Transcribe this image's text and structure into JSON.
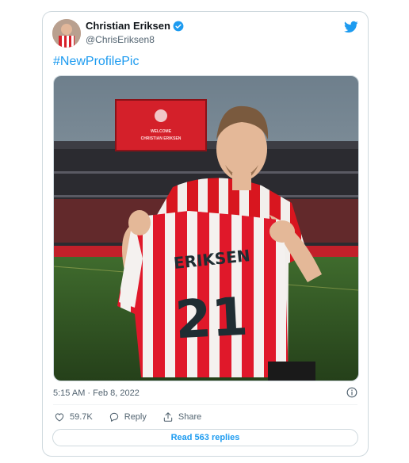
{
  "tweet": {
    "display_name": "Christian Eriksen",
    "handle": "@ChrisEriksen8",
    "text": "#NewProfilePic",
    "timestamp": "5:15 AM · Feb 8, 2022",
    "likes": "59.7K",
    "reply_label": "Reply",
    "share_label": "Share",
    "read_replies": "Read 563 replies"
  },
  "media": {
    "board_line1": "WELCOME",
    "board_line2": "CHRISTIAN ERIKSEN",
    "shirt_name": "ERIKSEN",
    "shirt_number": "21"
  },
  "colors": {
    "accent": "#1d9bf0",
    "text_secondary": "#536471",
    "border": "#cfd9de"
  },
  "icons": [
    "twitter-bird-icon",
    "verified-badge-icon",
    "info-icon",
    "heart-icon",
    "reply-icon",
    "share-icon"
  ]
}
